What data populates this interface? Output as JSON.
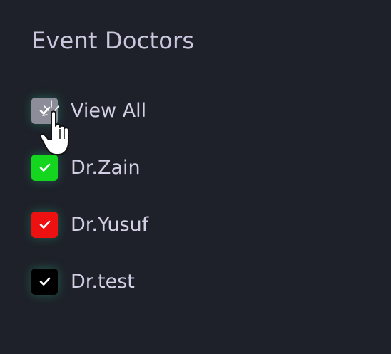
{
  "panel": {
    "title": "Event Doctors"
  },
  "filters": [
    {
      "label": "View All",
      "checked": true,
      "color": "#8d8d99",
      "check_icon": "checkmark-icon"
    },
    {
      "label": "Dr.Zain",
      "checked": true,
      "color": "#14d61e",
      "check_icon": "checkmark-icon"
    },
    {
      "label": "Dr.Yusuf",
      "checked": true,
      "color": "#ee1111",
      "check_icon": "checkmark-icon"
    },
    {
      "label": "Dr.test",
      "checked": true,
      "color": "#000000",
      "check_icon": "checkmark-icon"
    }
  ],
  "cursor": {
    "icon": "hand-pointer-icon"
  }
}
